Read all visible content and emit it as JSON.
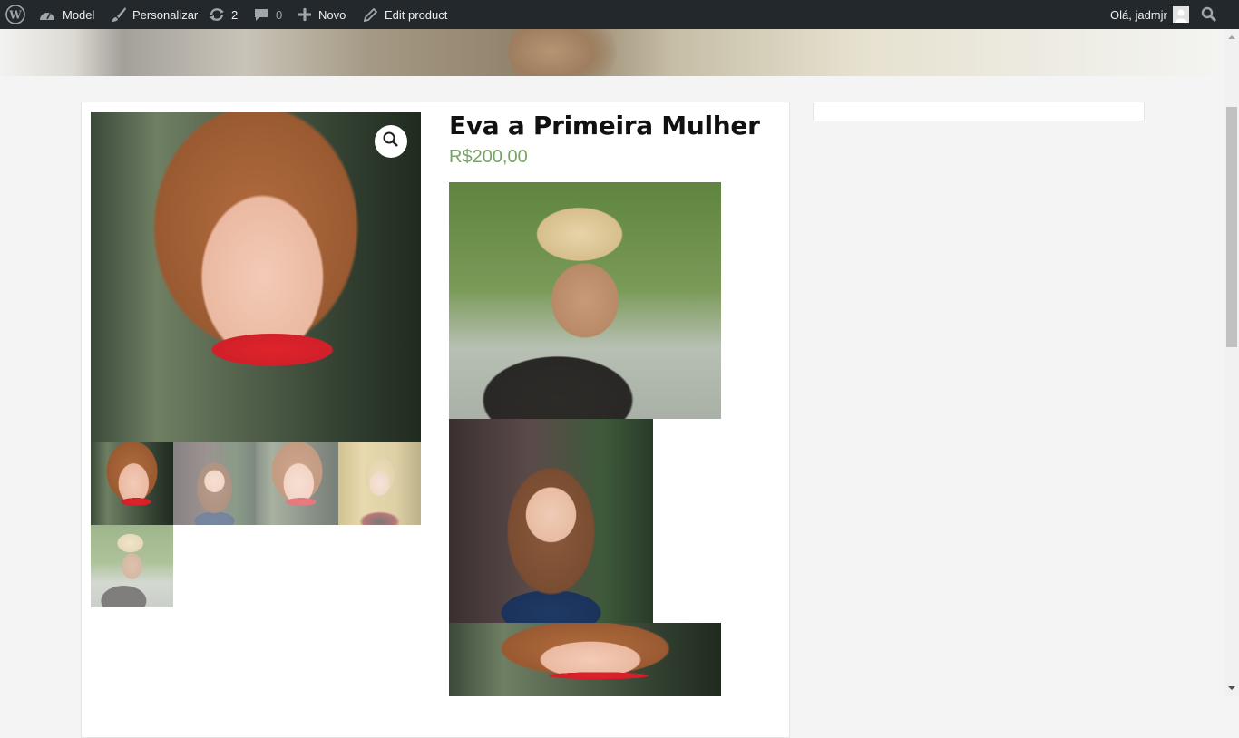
{
  "admin_bar": {
    "site_name": "Model",
    "customize_label": "Personalizar",
    "updates_count": "2",
    "comments_count": "0",
    "new_label": "Novo",
    "edit_label": "Edit product",
    "greeting": "Olá, jadmjr"
  },
  "product": {
    "title": "Eva a Primeira Mulher",
    "price": "R$200,00"
  },
  "icons": {
    "wp_logo": "wordpress-logo-icon",
    "dashboard": "dashboard-icon",
    "customize": "brush-icon",
    "updates": "updates-icon",
    "comments": "comment-icon",
    "new": "plus-icon",
    "edit": "pencil-icon",
    "avatar": "avatar-icon",
    "search": "search-icon",
    "zoom": "magnifier-icon"
  },
  "colors": {
    "admin_bar_bg": "#23282d",
    "price": "#77a464",
    "page_bg": "#f4f4f4"
  }
}
